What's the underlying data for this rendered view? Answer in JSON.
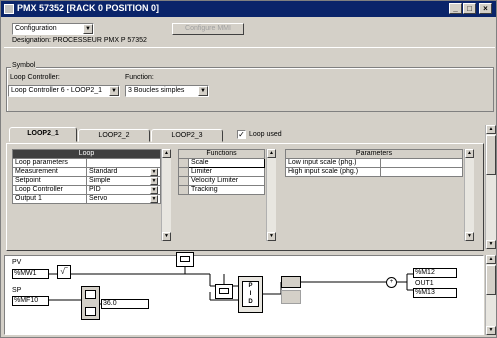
{
  "window": {
    "title": "PMX 57352 [RACK 0    POSITION 0]",
    "min_glyph": "_",
    "max_glyph": "□",
    "close_glyph": "×"
  },
  "header": {
    "view_select": "Configuration",
    "configure_button": "Configure MMI",
    "designation": "Designation: PROCESSEUR PMX P 57352"
  },
  "symbol": {
    "group_title": "Symbol",
    "loop_controller_label": "Loop Controller:",
    "loop_controller_value": "Loop Controller 6 - LOOP2_1",
    "function_label": "Function:",
    "function_value": "3 Boucles simples"
  },
  "tabs": {
    "items": [
      "LOOP2_1",
      "LOOP2_2",
      "LOOP2_3"
    ],
    "active": "LOOP2_1",
    "loop_used_label": "Loop used",
    "loop_used_checked": true
  },
  "loop_table": {
    "header": "Loop",
    "rows": [
      {
        "name": "Loop parameters",
        "value": ""
      },
      {
        "name": "Measurement",
        "value": "Standard"
      },
      {
        "name": "Setpoint",
        "value": "Simple"
      },
      {
        "name": "Loop Controller",
        "value": "PID"
      },
      {
        "name": "Output 1",
        "value": "Servo"
      }
    ]
  },
  "functions_table": {
    "header": "Functions",
    "items": [
      "Scale",
      "Limiter",
      "Velocity Limiter",
      "Tracking"
    ]
  },
  "parameters_table": {
    "header": "Parameters",
    "rows": [
      {
        "name": "Low input scale (phg.)",
        "value": ""
      },
      {
        "name": "High input scale (phg.)",
        "value": ""
      }
    ]
  },
  "diagram": {
    "pv_label": "PV",
    "pv_value": "%MW1",
    "sqrt_symbol": "√‾",
    "sp_label": "SP",
    "sp_value": "%MF10",
    "ratio_value": "36.0",
    "pid_label": "P\nI\nD",
    "out_top_value": "%M12",
    "out_label": "OUT1",
    "out_bottom_value": "%M13"
  }
}
